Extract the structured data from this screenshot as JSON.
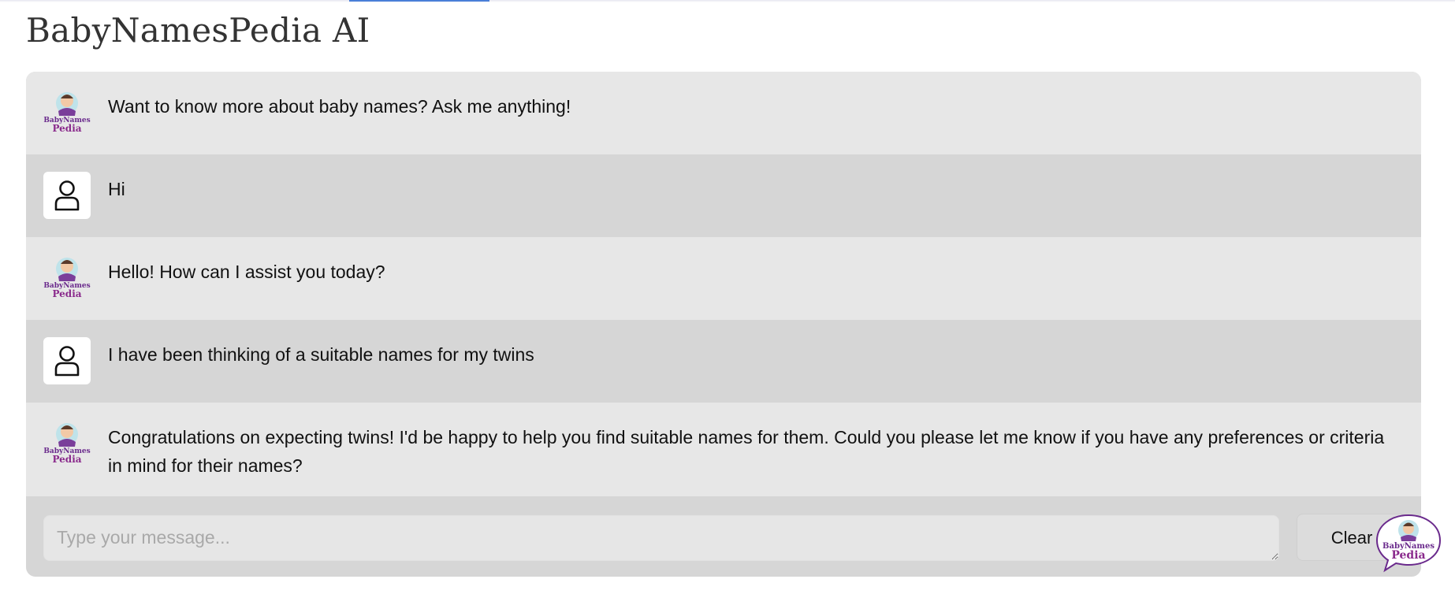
{
  "app": {
    "title": "BabyNamesPedia AI",
    "logo_icon": "babynamespedia-logo-icon",
    "user_icon": "user-icon"
  },
  "conversation": [
    {
      "role": "bot",
      "text": "Want to know more about baby names? Ask me anything!"
    },
    {
      "role": "user",
      "text": "Hi"
    },
    {
      "role": "bot",
      "text": "Hello! How can I assist you today?"
    },
    {
      "role": "user",
      "text": "I have been thinking of a suitable names for my twins"
    },
    {
      "role": "bot",
      "text": "Congratulations on expecting twins! I'd be happy to help you find suitable names for them. Could you please let me know if you have any preferences or criteria in mind for their names?"
    }
  ],
  "composer": {
    "placeholder": "Type your message...",
    "value": "",
    "clear_label": "Clear"
  },
  "colors": {
    "bot_row": "#e7e7e7",
    "user_row": "#d6d6d6",
    "logo_purple": "#6a2a8c",
    "accent_blue": "#4a7fd8"
  }
}
